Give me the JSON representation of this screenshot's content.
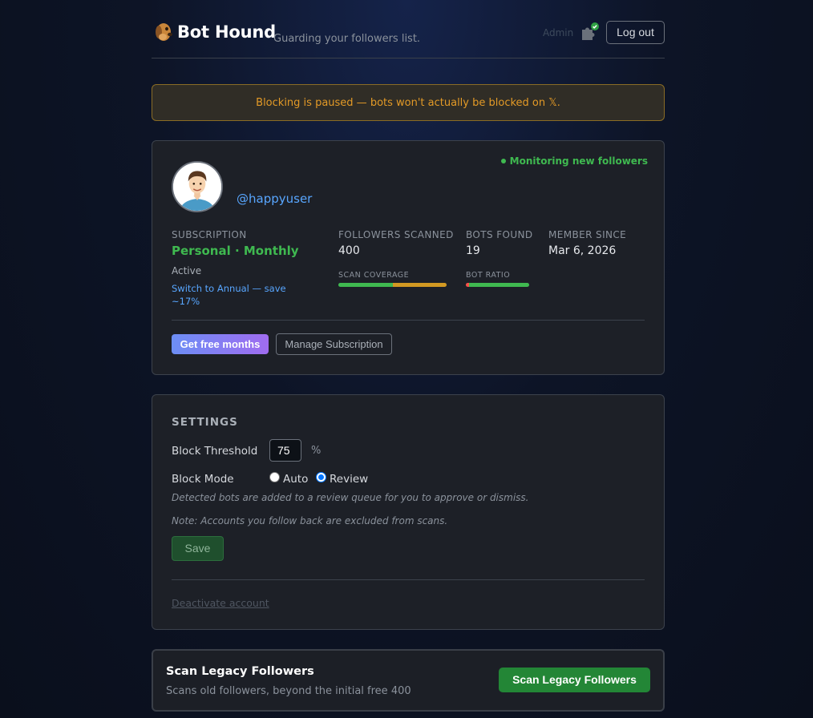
{
  "header": {
    "brand": "Bot Hound",
    "tagline": "Guarding your followers list.",
    "admin_label": "Admin",
    "logout_label": "Log out"
  },
  "warning": {
    "text": "Blocking is paused — bots won't actually be blocked on 𝕏."
  },
  "account": {
    "monitoring_text": "Monitoring new followers",
    "handle": "@happyuser",
    "subscription_label": "SUBSCRIPTION",
    "plan": "Personal · Monthly",
    "status": "Active",
    "switch_link": "Switch to Annual — save ~17%",
    "followers_scanned_label": "FOLLOWERS SCANNED",
    "followers_scanned": "400",
    "bots_found_label": "BOTS FOUND",
    "bots_found": "19",
    "member_since_label": "MEMBER SINCE",
    "member_since": "Mar 6, 2026",
    "scan_coverage_label": "SCAN COVERAGE",
    "scan_coverage_fraction": 0.5,
    "bot_ratio_label": "BOT RATIO",
    "bot_ratio_fraction": 0.0475,
    "get_free_months_label": "Get free months",
    "manage_subscription_label": "Manage Subscription"
  },
  "settings": {
    "title": "SETTINGS",
    "block_threshold_label": "Block Threshold",
    "block_threshold_value": "75",
    "percent_sign": "%",
    "block_mode_label": "Block Mode",
    "mode_auto_label": "Auto",
    "mode_review_label": "Review",
    "mode_selected": "Review",
    "mode_hint": "Detected bots are added to a review queue for you to approve or dismiss.",
    "note": "Note: Accounts you follow back are excluded from scans.",
    "save_label": "Save",
    "deactivate_label": "Deactivate account"
  },
  "legacy": {
    "title": "Scan Legacy Followers",
    "subtitle": "Scans old followers, beyond the initial free 400",
    "button_label": "Scan Legacy Followers"
  },
  "colors": {
    "accent_green": "#3fb950",
    "link_blue": "#58a6ff",
    "warning_orange": "#e39a26",
    "coverage_bar_a": "#3fb950",
    "coverage_bar_b": "#d29922",
    "bot_ratio_bar_a": "#f85149",
    "bot_ratio_bar_b": "#3fb950"
  }
}
